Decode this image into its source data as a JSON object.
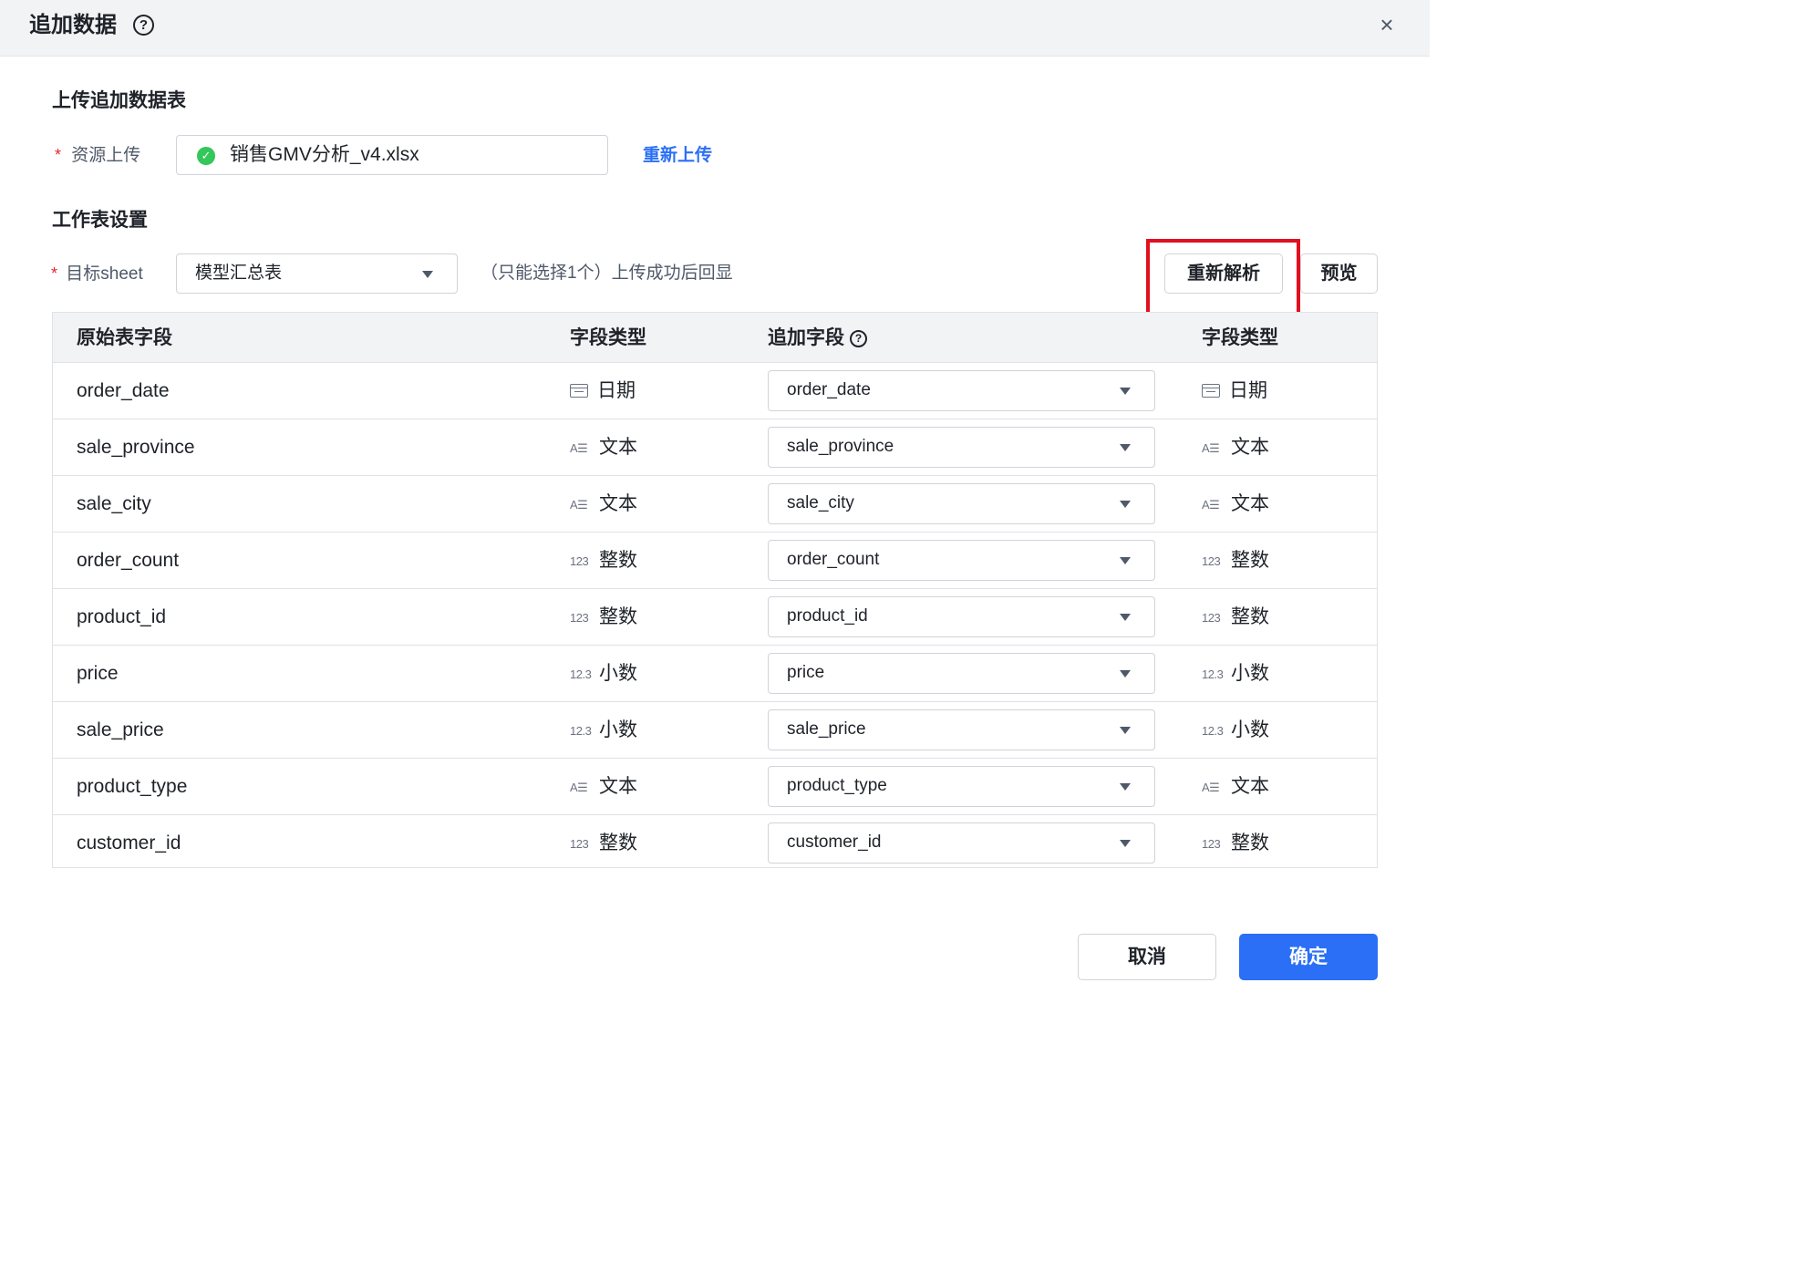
{
  "dialog": {
    "title": "追加数据",
    "help_icon": "question-circle-icon",
    "close_icon": "close-icon"
  },
  "upload_section": {
    "title": "上传追加数据表",
    "required_mark": "*",
    "label": "资源上传",
    "file_name": "销售GMV分析_v4.xlsx",
    "file_status_icon": "check-circle-icon",
    "reupload_link": "重新上传"
  },
  "sheet_section": {
    "title": "工作表设置",
    "required_mark": "*",
    "label": "目标sheet",
    "selected_sheet": "模型汇总表",
    "hint": "（只能选择1个）上传成功后回显",
    "reparse_button": "重新解析",
    "preview_button": "预览"
  },
  "table": {
    "headers": {
      "source_field": "原始表字段",
      "source_type": "字段类型",
      "append_field": "追加字段",
      "target_type": "字段类型"
    },
    "rows": [
      {
        "source": "order_date",
        "type_icon": "",
        "type": "日期",
        "append": "order_date",
        "target_icon": "",
        "target_type": "日期"
      },
      {
        "source": "sale_province",
        "type_icon": "A☰",
        "type": "文本",
        "append": "sale_province",
        "target_icon": "A☰",
        "target_type": "文本"
      },
      {
        "source": "sale_city",
        "type_icon": "A☰",
        "type": "文本",
        "append": "sale_city",
        "target_icon": "A☰",
        "target_type": "文本"
      },
      {
        "source": "order_count",
        "type_icon": "123",
        "type": "整数",
        "append": "order_count",
        "target_icon": "123",
        "target_type": "整数"
      },
      {
        "source": "product_id",
        "type_icon": "123",
        "type": "整数",
        "append": "product_id",
        "target_icon": "123",
        "target_type": "整数"
      },
      {
        "source": "price",
        "type_icon": "12.3",
        "type": "小数",
        "append": "price",
        "target_icon": "12.3",
        "target_type": "小数"
      },
      {
        "source": "sale_price",
        "type_icon": "12.3",
        "type": "小数",
        "append": "sale_price",
        "target_icon": "12.3",
        "target_type": "小数"
      },
      {
        "source": "product_type",
        "type_icon": "A☰",
        "type": "文本",
        "append": "product_type",
        "target_icon": "A☰",
        "target_type": "文本"
      },
      {
        "source": "customer_id",
        "type_icon": "123",
        "type": "整数",
        "append": "customer_id",
        "target_icon": "123",
        "target_type": "整数"
      }
    ]
  },
  "footer": {
    "cancel_button": "取消",
    "confirm_button": "确定"
  },
  "colors": {
    "primary": "#2a6ff6",
    "highlight": "#e0101f",
    "success": "#34c759",
    "required": "#e6262e"
  }
}
